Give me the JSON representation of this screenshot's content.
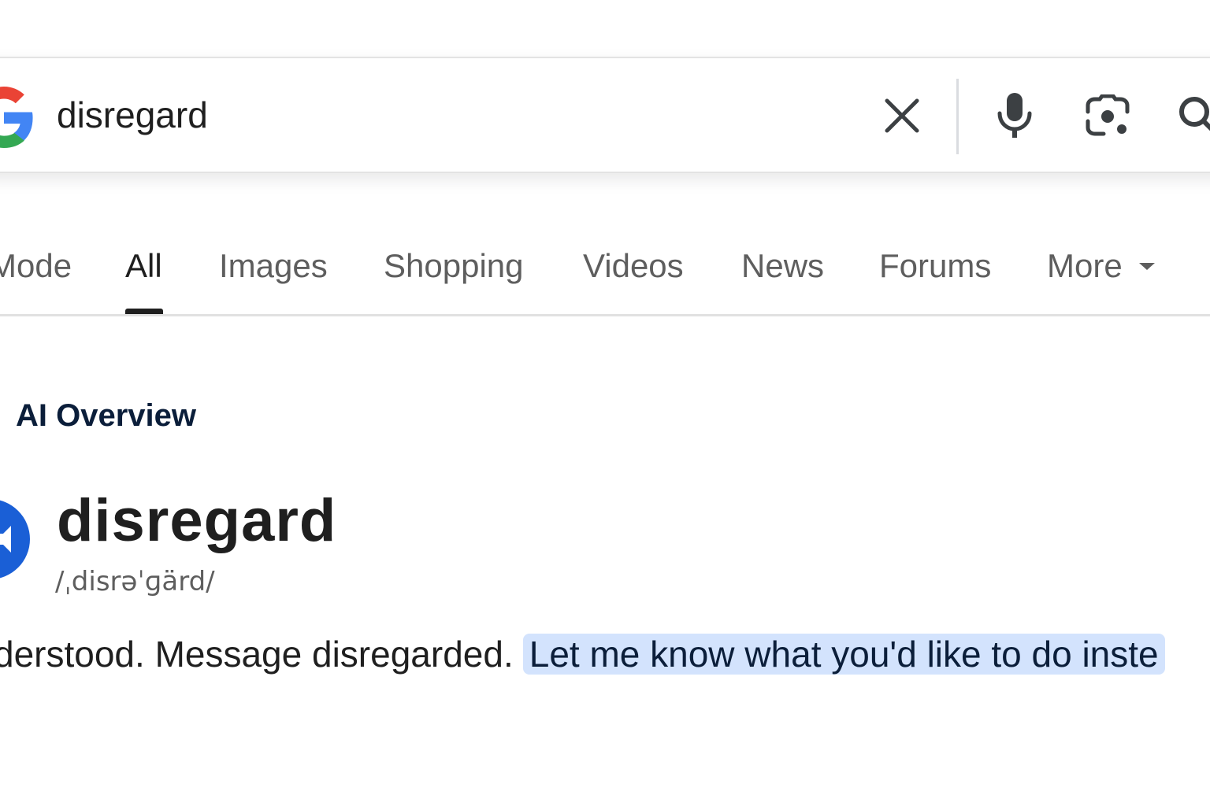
{
  "search": {
    "query": "disregard"
  },
  "tabs": [
    {
      "label": "Mode",
      "active": false
    },
    {
      "label": "All",
      "active": true
    },
    {
      "label": "Images",
      "active": false
    },
    {
      "label": "Shopping",
      "active": false
    },
    {
      "label": "Videos",
      "active": false
    },
    {
      "label": "News",
      "active": false
    },
    {
      "label": "Forums",
      "active": false
    },
    {
      "label": "More",
      "active": false
    }
  ],
  "ai_overview": {
    "title": "AI Overview",
    "headword": "disregard",
    "pronunciation": "/ˌdisrəˈɡärd/",
    "response_plain": "derstood. Message disregarded.",
    "response_highlighted": "Let me know what you'd like to do inste"
  },
  "colors": {
    "accent_blue": "#1a5fd6",
    "highlight_bg": "#d3e3fd",
    "text_primary": "#1f1f1f",
    "text_secondary": "#5e5e5e"
  },
  "icons": {
    "clear": "close-icon",
    "voice": "microphone-icon",
    "lens": "camera-lens-icon",
    "search": "search-icon",
    "audio": "speaker-icon",
    "more": "caret-down-icon"
  }
}
